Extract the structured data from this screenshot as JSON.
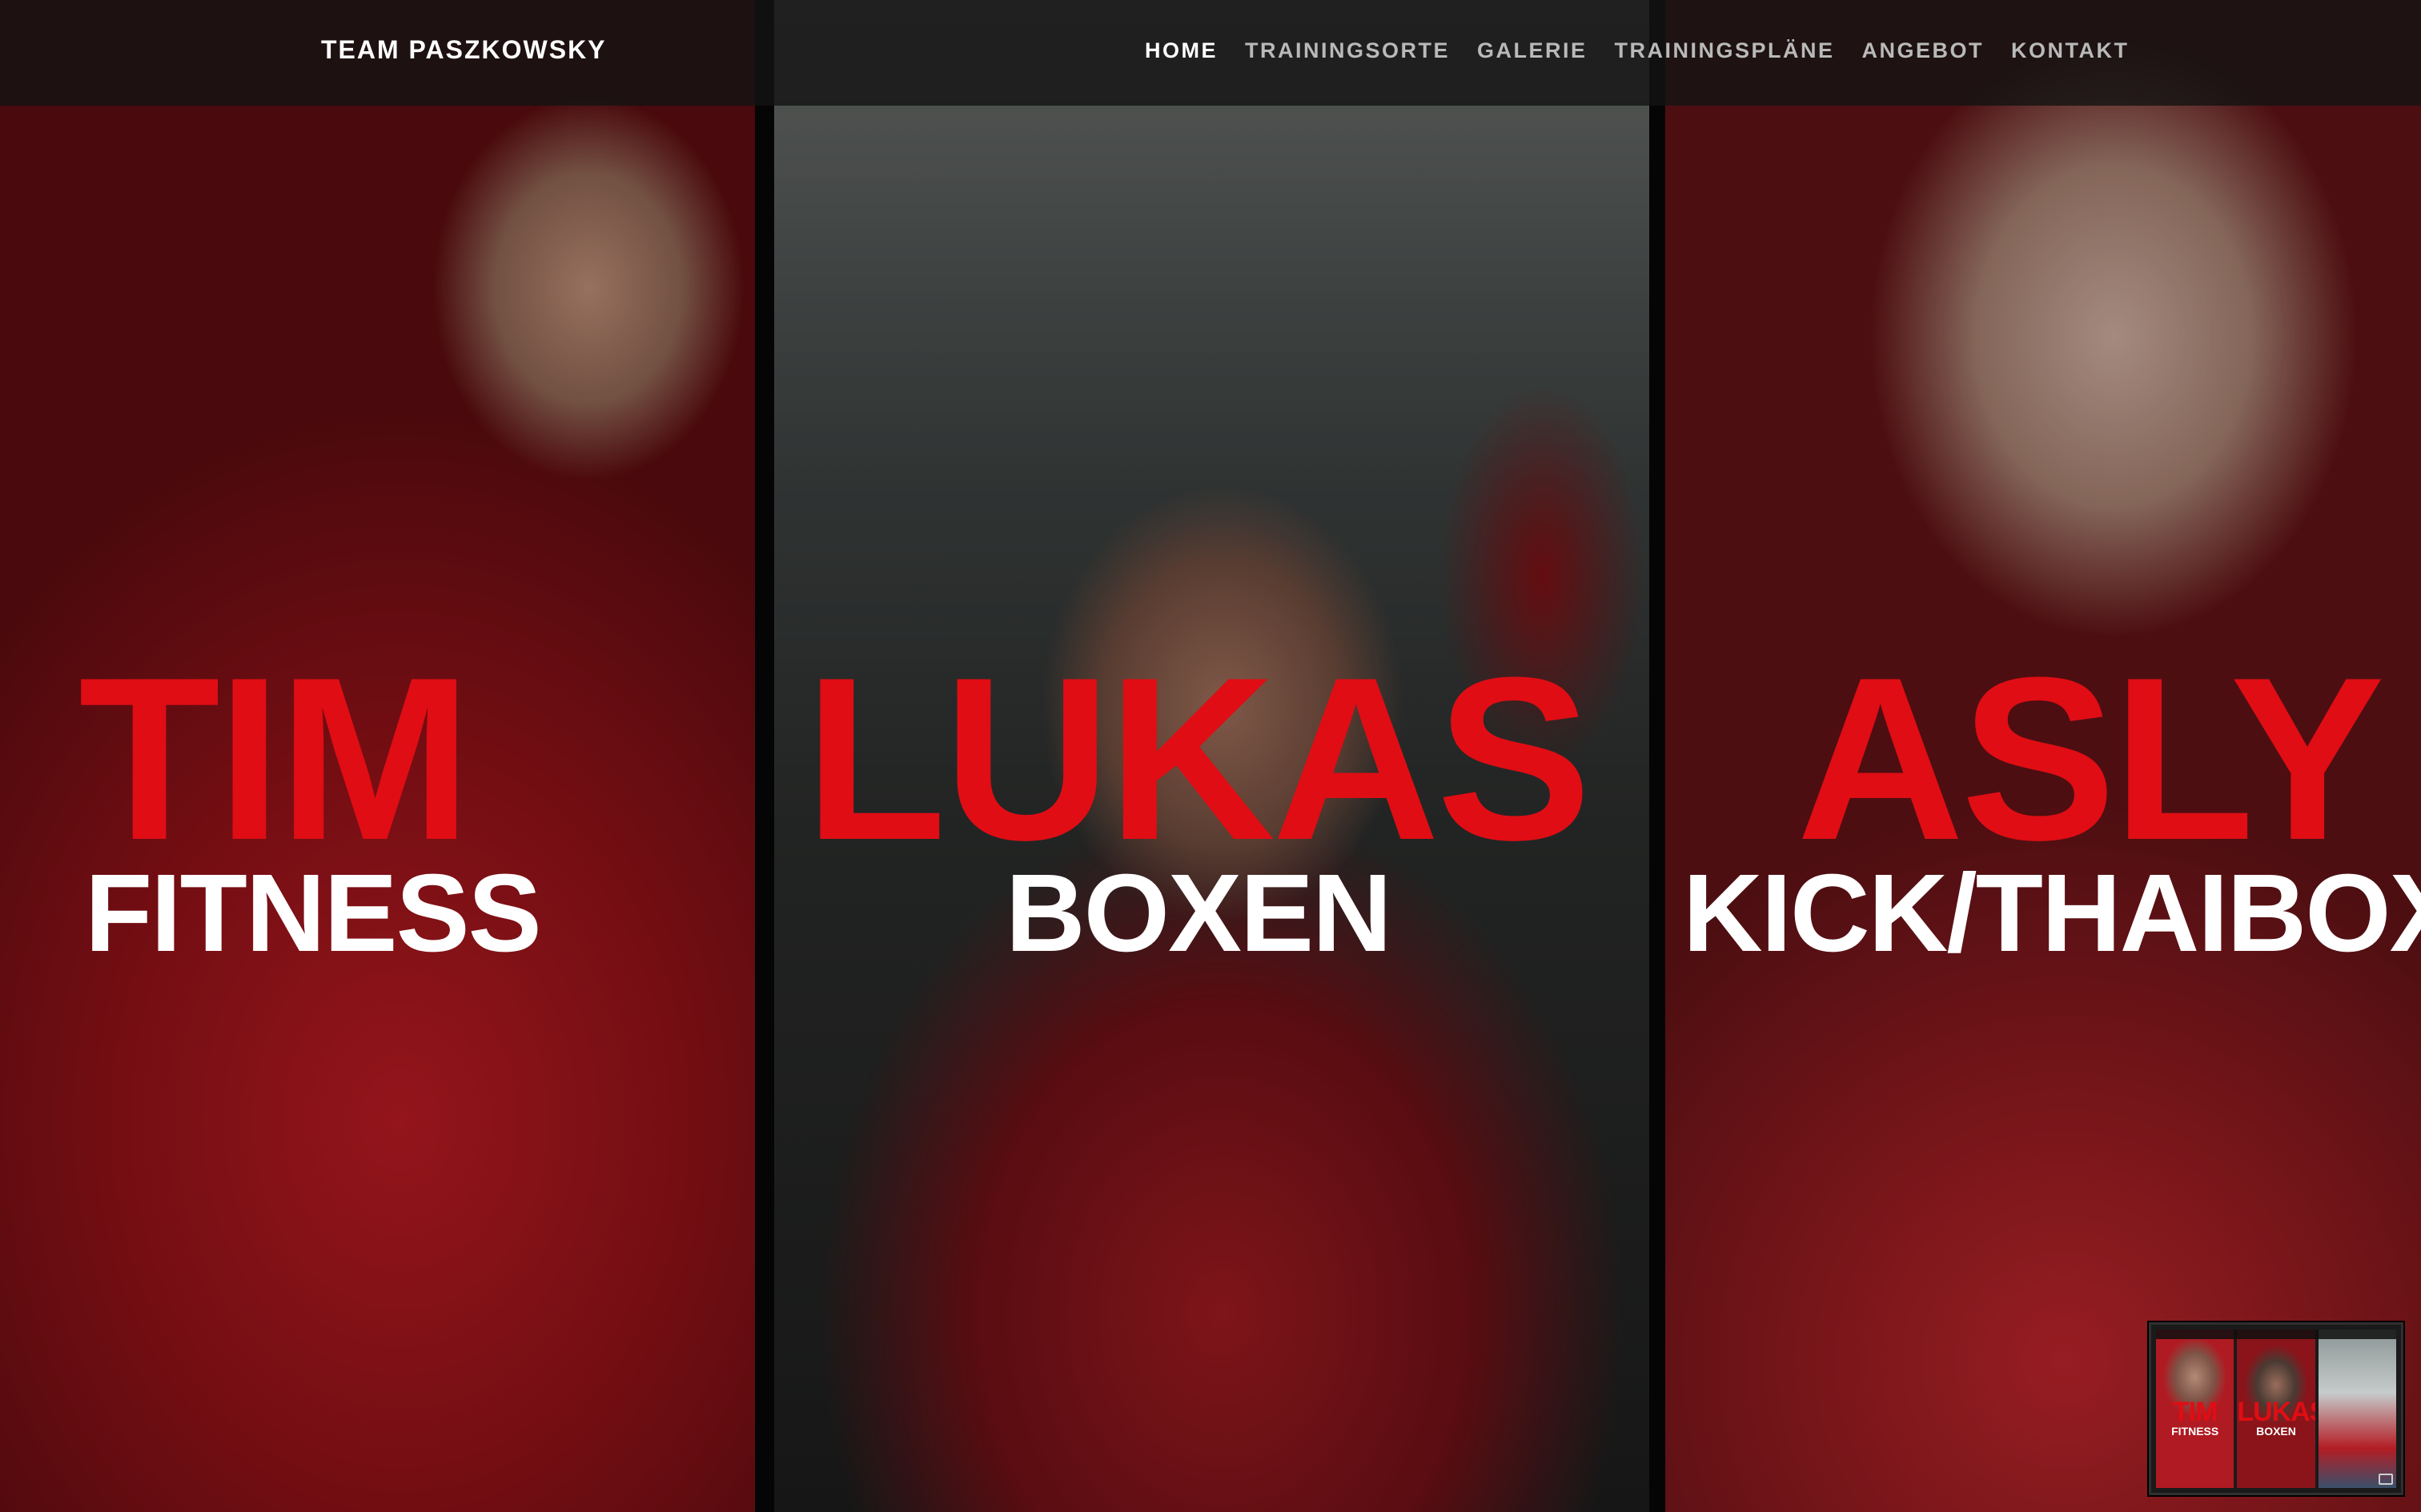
{
  "brand": "TEAM PASZKOWSKY",
  "nav": {
    "items": [
      {
        "label": "HOME",
        "active": true
      },
      {
        "label": "TRAININGSORTE",
        "active": false
      },
      {
        "label": "GALERIE",
        "active": false
      },
      {
        "label": "TRAININGSPLÄNE",
        "active": false
      },
      {
        "label": "ANGEBOT",
        "active": false
      },
      {
        "label": "KONTAKT",
        "active": false
      }
    ]
  },
  "hero": {
    "panels": [
      {
        "name": "TIM",
        "discipline": "FITNESS"
      },
      {
        "name": "LUKAS",
        "discipline": "BOXEN"
      },
      {
        "name": "ASLY",
        "discipline": "KICK/THAIBOXEN"
      }
    ]
  },
  "preview": {
    "panels": [
      {
        "name": "TIM",
        "discipline": "FITNESS"
      },
      {
        "name": "LUKAS",
        "discipline": "BOXEN"
      }
    ]
  },
  "colors": {
    "name_red": "#e00d14",
    "discipline_white": "#ffffff",
    "navbar_bg": "#141414",
    "nav_inactive": "#b9b9b9"
  }
}
